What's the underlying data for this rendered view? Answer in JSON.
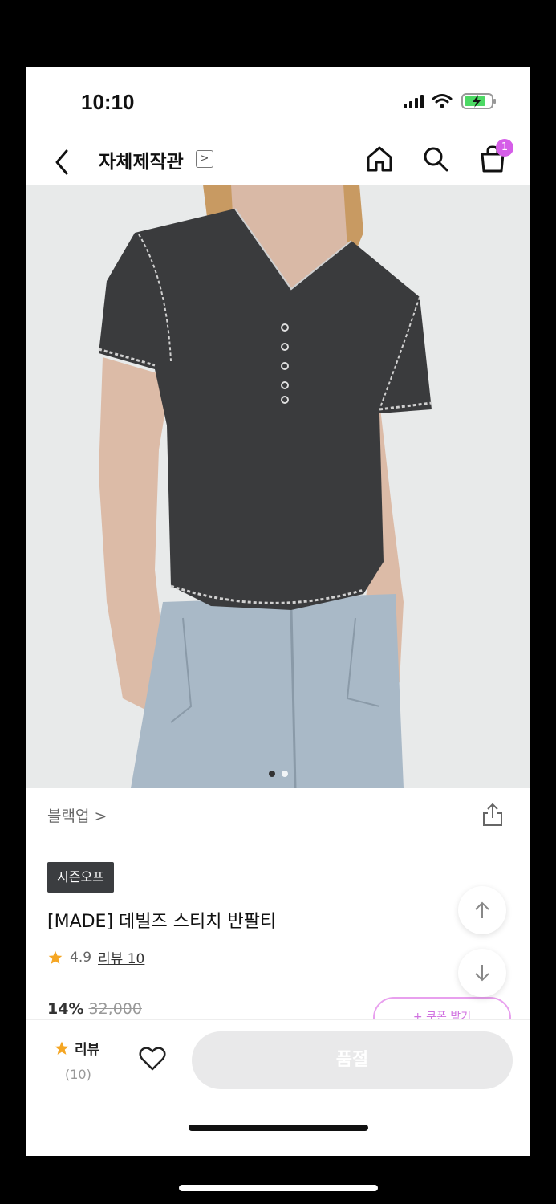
{
  "status_bar": {
    "time": "10:10"
  },
  "nav": {
    "store_title": "자체제작관",
    "store_arrow": ">",
    "cart_count": "1"
  },
  "gallery": {
    "page_count": 2,
    "active_page": 1
  },
  "product": {
    "category": "블랙업 >",
    "tag": "시즌오프",
    "name": "[MADE] 데빌즈 스티치 반팔티",
    "rating": "4.9",
    "review_label": "리뷰 10",
    "discount": "14%",
    "original_price": "32,000",
    "coupon_label": "+ 쿠폰 받기"
  },
  "bottom_bar": {
    "review_label": "리뷰",
    "review_count": "(10)",
    "soldout_label": "품절"
  },
  "colors": {
    "accent": "#d55de8",
    "star": "#f5a623",
    "soldout_bg": "#e9e9ea"
  }
}
